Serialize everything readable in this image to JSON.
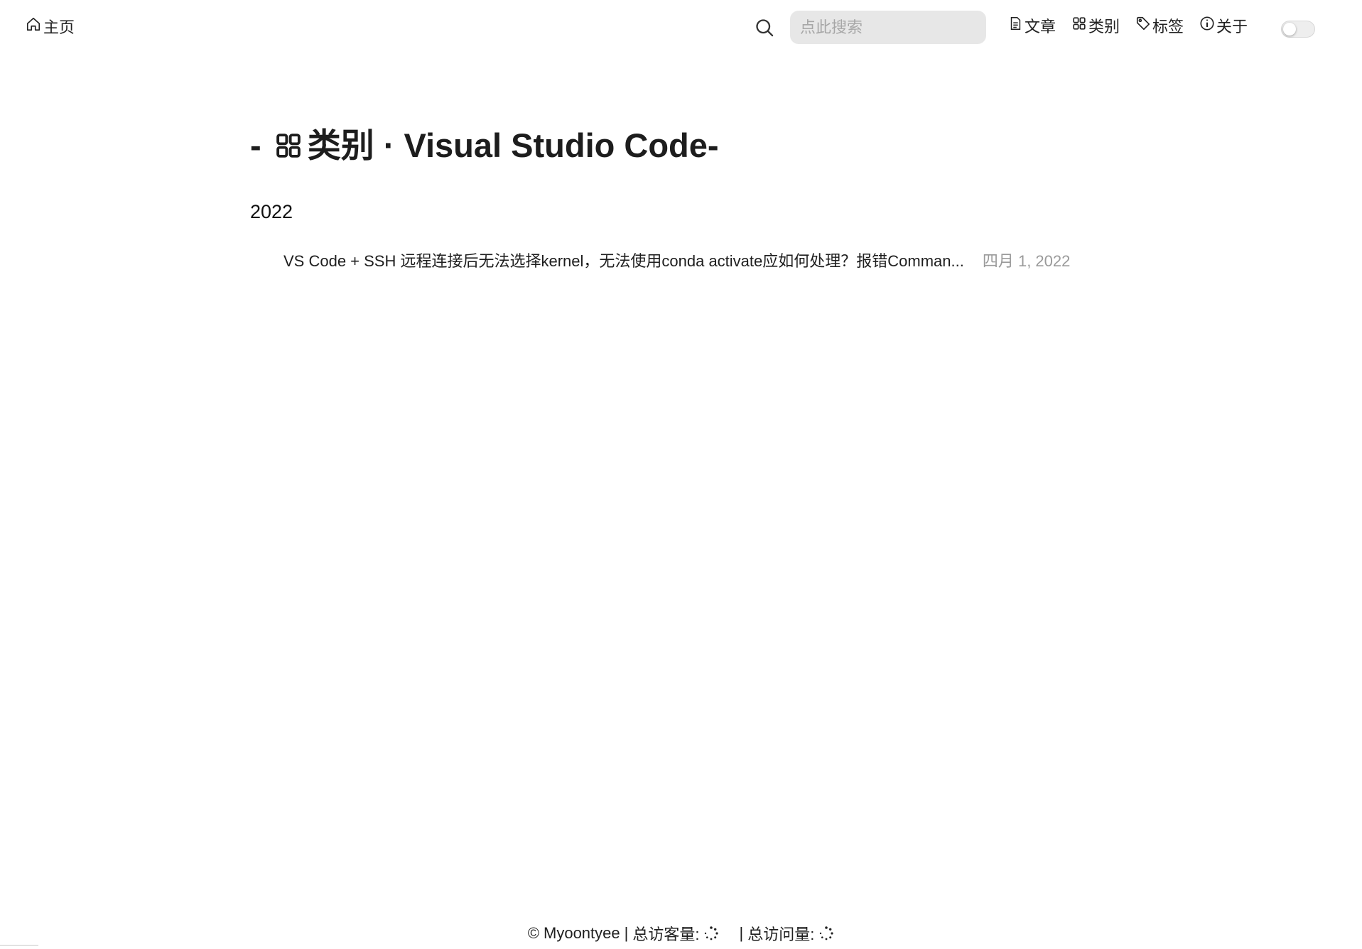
{
  "header": {
    "home_label": "主页",
    "search_placeholder": "点此搜索",
    "nav": [
      {
        "label": "文章",
        "icon": "document-icon"
      },
      {
        "label": "类别",
        "icon": "grid-icon"
      },
      {
        "label": "标签",
        "icon": "tag-icon"
      },
      {
        "label": "关于",
        "icon": "info-icon"
      }
    ],
    "theme_toggle_on": false
  },
  "main": {
    "title_prefix": "- ",
    "title_category": "类别",
    "title_suffix": " · Visual Studio Code-",
    "year": "2022",
    "posts": [
      {
        "title": "VS Code + SSH 远程连接后无法选择kernel，无法使用conda activate应如何处理？报错Comman...",
        "date": "四月 1, 2022"
      }
    ]
  },
  "footer": {
    "copyright": "© Myoontyee",
    "visitors_label": "总访客量:",
    "views_label": "总访问量:"
  },
  "colors": {
    "search_bg": "#e7e7e7",
    "date_text": "#9a9a9a",
    "text": "#1f1f1f"
  }
}
